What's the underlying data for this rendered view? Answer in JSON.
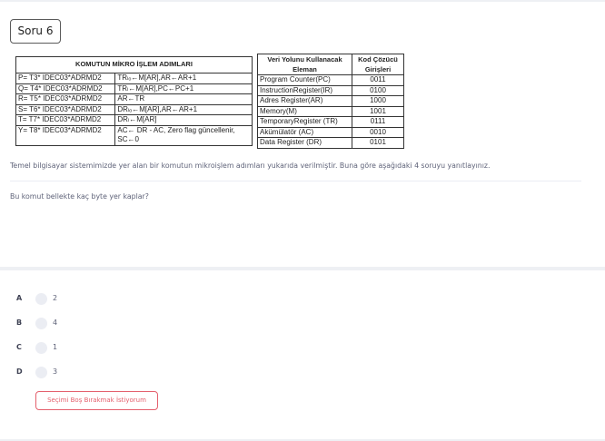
{
  "question_badge": "Soru 6",
  "micro_table": {
    "header": "KOMUTUN MİKRO İŞLEM ADIMLARI",
    "rows": [
      [
        "P= T3* IDEC03*ADRMD2",
        "TRₗₒ←M[AR],AR←AR+1"
      ],
      [
        "Q= T4* IDEC03*ADRMD2",
        "TRₗ←M[AR],PC←PC+1"
      ],
      [
        "R= T5* IDEC03*ADRMD2",
        "AR←TR"
      ],
      [
        "S= T6* IDEC03*ADRMD2",
        "DRₗₒ←M[AR],AR←AR+1"
      ],
      [
        "T= T7* IDEC03*ADRMD2",
        "DRₗ←M[AR]"
      ],
      [
        "Y= T8* IDEC03*ADRMD2",
        "AC← DR - AC, Zero flag güncellenir,\nSC←0"
      ]
    ]
  },
  "code_table": {
    "headers": [
      "Veri Yolunu Kullanacak Eleman",
      "Kod Çözücü Girişleri"
    ],
    "rows": [
      [
        "Program Counter(PC)",
        "0011"
      ],
      [
        "InstructionRegister(IR)",
        "0100"
      ],
      [
        "Adres Register(AR)",
        "1000"
      ],
      [
        "Memory(M)",
        "1001"
      ],
      [
        "TemporaryRegister (TR)",
        "0111"
      ],
      [
        "Akümülatör (AC)",
        "0010"
      ],
      [
        "Data Register (DR)",
        "0101"
      ]
    ]
  },
  "info_text": "Temel bilgisayar sistemimizde yer alan bir komutun mikroişlem adımları yukarıda verilmiştir. Buna göre aşağıdaki 4 soruyu yanıtlayınız.",
  "question_text": "Bu komut bellekte kaç byte yer kaplar?",
  "options": [
    {
      "letter": "A",
      "text": "2"
    },
    {
      "letter": "B",
      "text": "4"
    },
    {
      "letter": "C",
      "text": "1"
    },
    {
      "letter": "D",
      "text": "3"
    }
  ],
  "empty_button_label": "Seçimi Boş Bırakmak İstiyorum",
  "colors": {
    "accent_red": "#e4606d",
    "text_muted": "#5e6278",
    "radio_bg": "#ebedf3"
  }
}
